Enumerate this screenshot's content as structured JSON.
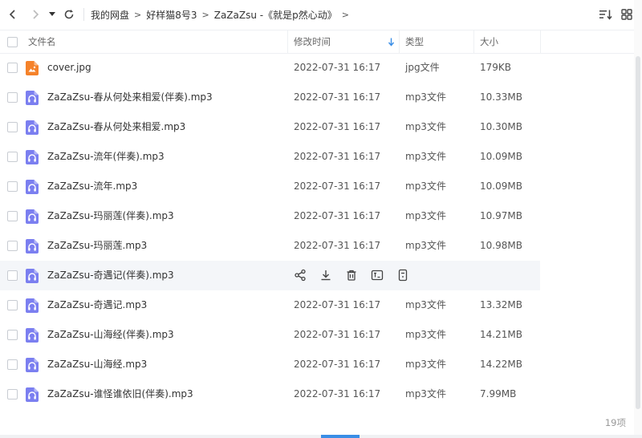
{
  "toolbar": {
    "breadcrumb": [
      {
        "label": "我的网盘"
      },
      {
        "label": "好样猫8号3"
      },
      {
        "label": "ZaZaZsu -《就是p然心动》"
      }
    ]
  },
  "table": {
    "headers": {
      "name": "文件名",
      "modified": "修改时间",
      "type": "类型",
      "size": "大小"
    },
    "rows": [
      {
        "name": "cover.jpg",
        "icon": "image-file-icon",
        "date": "2022-07-31 16:17",
        "type": "jpg文件",
        "size": "179KB"
      },
      {
        "name": "ZaZaZsu-春从何处来相爱(伴奏).mp3",
        "icon": "audio-file-icon",
        "date": "2022-07-31 16:17",
        "type": "mp3文件",
        "size": "10.33MB"
      },
      {
        "name": "ZaZaZsu-春从何处来相爱.mp3",
        "icon": "audio-file-icon",
        "date": "2022-07-31 16:17",
        "type": "mp3文件",
        "size": "10.30MB"
      },
      {
        "name": "ZaZaZsu-流年(伴奏).mp3",
        "icon": "audio-file-icon",
        "date": "2022-07-31 16:17",
        "type": "mp3文件",
        "size": "10.09MB"
      },
      {
        "name": "ZaZaZsu-流年.mp3",
        "icon": "audio-file-icon",
        "date": "2022-07-31 16:17",
        "type": "mp3文件",
        "size": "10.09MB"
      },
      {
        "name": "ZaZaZsu-玛丽莲(伴奏).mp3",
        "icon": "audio-file-icon",
        "date": "2022-07-31 16:17",
        "type": "mp3文件",
        "size": "10.97MB"
      },
      {
        "name": "ZaZaZsu-玛丽莲.mp3",
        "icon": "audio-file-icon",
        "date": "2022-07-31 16:17",
        "type": "mp3文件",
        "size": "10.98MB"
      },
      {
        "name": "ZaZaZsu-奇遇记(伴奏).mp3",
        "icon": "audio-file-icon",
        "date": "",
        "type": "",
        "size": "",
        "hovered": true
      },
      {
        "name": "ZaZaZsu-奇遇记.mp3",
        "icon": "audio-file-icon",
        "date": "2022-07-31 16:17",
        "type": "mp3文件",
        "size": "13.32MB"
      },
      {
        "name": "ZaZaZsu-山海经(伴奏).mp3",
        "icon": "audio-file-icon",
        "date": "2022-07-31 16:17",
        "type": "mp3文件",
        "size": "14.21MB"
      },
      {
        "name": "ZaZaZsu-山海经.mp3",
        "icon": "audio-file-icon",
        "date": "2022-07-31 16:17",
        "type": "mp3文件",
        "size": "14.22MB"
      },
      {
        "name": "ZaZaZsu-谁怪谁依旧(伴奏).mp3",
        "icon": "audio-file-icon",
        "date": "2022-07-31 16:17",
        "type": "mp3文件",
        "size": "7.99MB"
      }
    ]
  },
  "footer": {
    "count_label": "19项"
  },
  "colors": {
    "image_icon": "#f5822a",
    "audio_icon": "#7b7ff0",
    "accent": "#3a8ee6"
  }
}
